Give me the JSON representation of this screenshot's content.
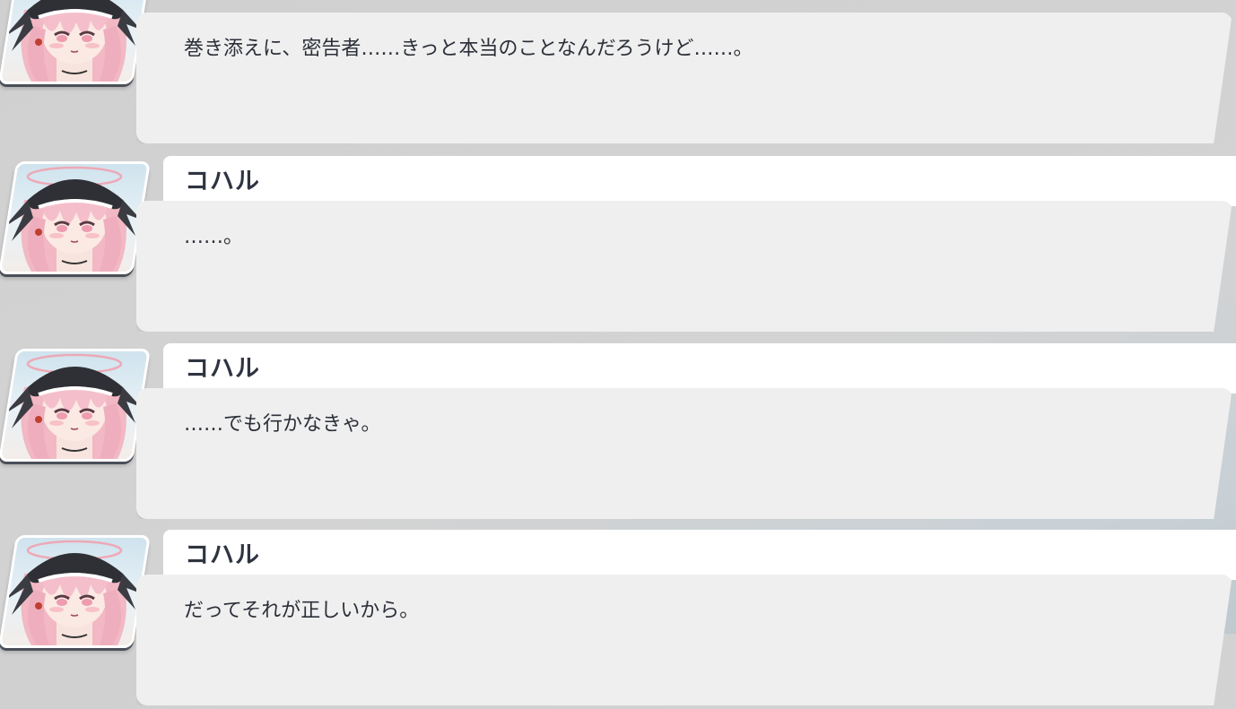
{
  "log": {
    "entries": [
      {
        "speaker": "",
        "text": "巻き添えに、密告者……きっと本当のことなんだろうけど……。"
      },
      {
        "speaker": "コハル",
        "text": "……。"
      },
      {
        "speaker": "コハル",
        "text": "……でも行かなきゃ。"
      },
      {
        "speaker": "コハル",
        "text": "だってそれが正しいから。"
      }
    ]
  },
  "colors": {
    "bubble": "#efefef",
    "name_bar": "#ffffff",
    "name_text": "#2e3440",
    "dialogue_text": "#2b2f38",
    "hair": "#f2b8c4",
    "hat": "#2f3035"
  },
  "icons": {
    "avatar": "koharu-portrait-icon"
  }
}
